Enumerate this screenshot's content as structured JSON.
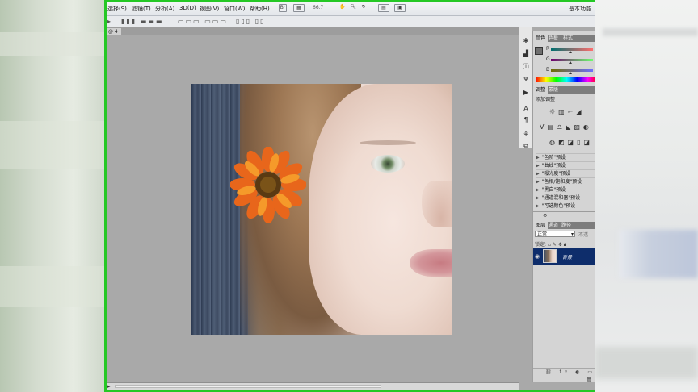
{
  "menubar": {
    "items": [
      "选择(S)",
      "滤镜(T)",
      "分析(A)",
      "3D(D)",
      "视图(V)",
      "窗口(W)",
      "帮助(H)"
    ],
    "zoom": "66.7",
    "workspace": "基本功能"
  },
  "document": {
    "tab_label": "@ 4"
  },
  "panels": {
    "color_tabs": [
      "颜色",
      "色板",
      "样式"
    ],
    "channels": [
      "R",
      "G",
      "B"
    ],
    "adjust_tabs": [
      "调整",
      "蒙版"
    ],
    "adjust_title": "添加调整",
    "presets": [
      "\"色阶\"预设",
      "\"曲线\"预设",
      "\"曝光度\"预设",
      "\"色相/饱和度\"预设",
      "\"黑白\"预设",
      "\"通道混和器\"预设",
      "\"可选颜色\"预设"
    ],
    "layers_tabs": [
      "图层",
      "通道",
      "路径"
    ],
    "blend_mode": "正常",
    "opacity_label": "不透",
    "lock_label": "锁定:",
    "layer_name": "背景"
  },
  "colors": {
    "accent_green": "#25c825",
    "layer_selected": "#0e2d6b"
  }
}
